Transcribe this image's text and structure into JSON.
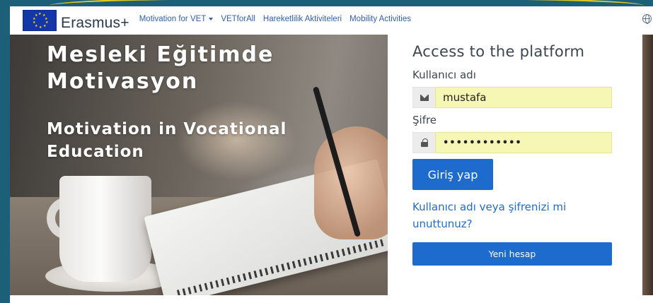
{
  "brand": {
    "name": "Erasmus+"
  },
  "nav": {
    "items": [
      {
        "label": "Motivation for VET",
        "dropdown": true
      },
      {
        "label": "VETforAll"
      },
      {
        "label": "Hareketlilik Aktiviteleri"
      },
      {
        "label": "Mobility Activities"
      }
    ]
  },
  "hero": {
    "title": "Mesleki Eğitimde Motivasyon",
    "subtitle": "Motivation in Vocational Education"
  },
  "login": {
    "title": "Access to the platform",
    "username_label": "Kullanıcı adı",
    "username_value": "mustafa",
    "password_label": "Şifre",
    "password_value": "••••••••••••",
    "submit_label": "Giriş yap",
    "forgot_label": "Kullanıcı adı veya şifrenizi mi unuttunuz?",
    "signup_label": "Yeni hesap"
  },
  "colors": {
    "frame": "#1b5f78",
    "accent": "#1d6ccd",
    "link": "#2f5fb0",
    "autofill": "#f7f7b5",
    "eu_blue": "#1336a8",
    "eu_star": "#ffdd00"
  },
  "icons": {
    "language": "globe-icon",
    "username": "envelope-icon",
    "password": "lock-icon",
    "dropdown": "caret-down-icon"
  }
}
